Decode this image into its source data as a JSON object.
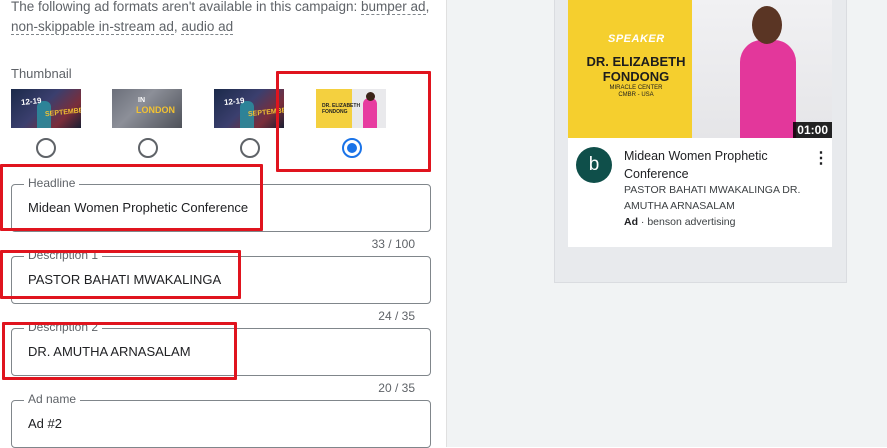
{
  "notice": {
    "prefix": "The following ad formats aren't available in this campaign: ",
    "formats": [
      "bumper ad",
      "non-skippable in-stream ad",
      "audio ad"
    ]
  },
  "thumbnail": {
    "label": "Thumbnail",
    "options": [
      {
        "caption_line1": "12-19",
        "caption_line2": "SEPTEMBER",
        "selected": false
      },
      {
        "caption_line1": "IN",
        "caption_line2": "LONDON",
        "selected": false
      },
      {
        "caption_line1": "12-19",
        "caption_line2": "SEPTEMBER",
        "selected": false
      },
      {
        "caption_line1": "DR. ELIZABETH",
        "caption_line2": "FONDONG",
        "selected": true
      }
    ]
  },
  "fields": {
    "headline": {
      "label": "Headline",
      "value": "Midean Women Prophetic Conference",
      "counter": "33 / 100"
    },
    "description1": {
      "label": "Description 1",
      "value": "PASTOR BAHATI MWAKALINGA",
      "counter": "24 / 35"
    },
    "description2": {
      "label": "Description 2",
      "value": "DR. AMUTHA ARNASALAM",
      "counter": "20 / 35"
    },
    "ad_name": {
      "label": "Ad name",
      "value": "Ad #2"
    }
  },
  "preview": {
    "video": {
      "speaker": "SPEAKER",
      "name_line1": "DR. ELIZABETH",
      "name_line2": "FONDONG",
      "place_line1": "MIRACLE CENTER",
      "place_line2": "CMBR - USA",
      "duration": "01:00"
    },
    "avatar_letter": "b",
    "title": "Midean Women Prophetic Conference",
    "description": "PASTOR BAHATI MWAKALINGA DR. AMUTHA ARNASALAM",
    "ad_badge": "Ad",
    "separator": " · ",
    "advertiser": "benson advertising",
    "menu_icon": "more-vert-icon"
  },
  "colors": {
    "highlight": "#e0141e",
    "radio_selected": "#1a73e8",
    "avatar_bg": "#0f4f4a",
    "thumbnail_yellow": "#f5cf2e",
    "speaker_pink": "#e3379b"
  }
}
